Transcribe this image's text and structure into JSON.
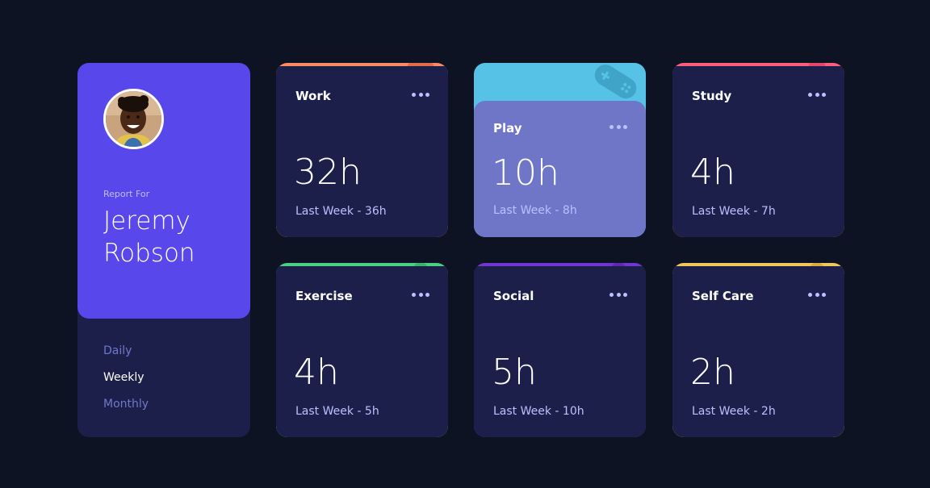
{
  "profile": {
    "report_label": "Report For",
    "name": "Jeremy Robson",
    "avatar_color": "#b5744c"
  },
  "periods": [
    {
      "label": "Daily",
      "active": false
    },
    {
      "label": "Weekly",
      "active": true
    },
    {
      "label": "Monthly",
      "active": false
    }
  ],
  "cards": [
    {
      "title": "Work",
      "hours": "32h",
      "previous": "Last Week - 36h",
      "accent": "#ff8b64",
      "icon": "briefcase-icon"
    },
    {
      "title": "Play",
      "hours": "10h",
      "previous": "Last Week - 8h",
      "accent": "#55c2e6",
      "icon": "gamepad-icon"
    },
    {
      "title": "Study",
      "hours": "4h",
      "previous": "Last Week - 7h",
      "accent": "#ff5e7d",
      "icon": "book-icon"
    },
    {
      "title": "Exercise",
      "hours": "4h",
      "previous": "Last Week - 5h",
      "accent": "#4bcf82",
      "icon": "running-icon"
    },
    {
      "title": "Social",
      "hours": "5h",
      "previous": "Last Week - 10h",
      "accent": "#7335d2",
      "icon": "chat-icon"
    },
    {
      "title": "Self Care",
      "hours": "2h",
      "previous": "Last Week - 2h",
      "accent": "#f1c75b",
      "icon": "heart-icon"
    }
  ]
}
